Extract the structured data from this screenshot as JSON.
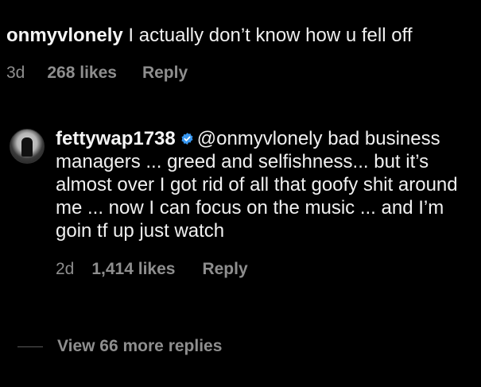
{
  "parent_comment": {
    "username": "onmyvlonely",
    "text": "I actually don’t know how u fell off",
    "time": "3d",
    "likes": "268 likes",
    "reply_label": "Reply"
  },
  "reply_comment": {
    "username": "fettywap1738",
    "verified": true,
    "mention": "@onmyvlonely",
    "text": "bad business managers ... greed and selfishness... but it’s almost over I got rid of all that goofy shit around me ... now I can focus on the music ... and I’m goin tf up just watch",
    "time": "2d",
    "likes": "1,414 likes",
    "reply_label": "Reply"
  },
  "view_more_replies": "View 66 more replies",
  "colors": {
    "background": "#000000",
    "primary_text": "#f2f2f2",
    "secondary_text": "#8e8e8e",
    "verified_blue": "#3897f0"
  }
}
